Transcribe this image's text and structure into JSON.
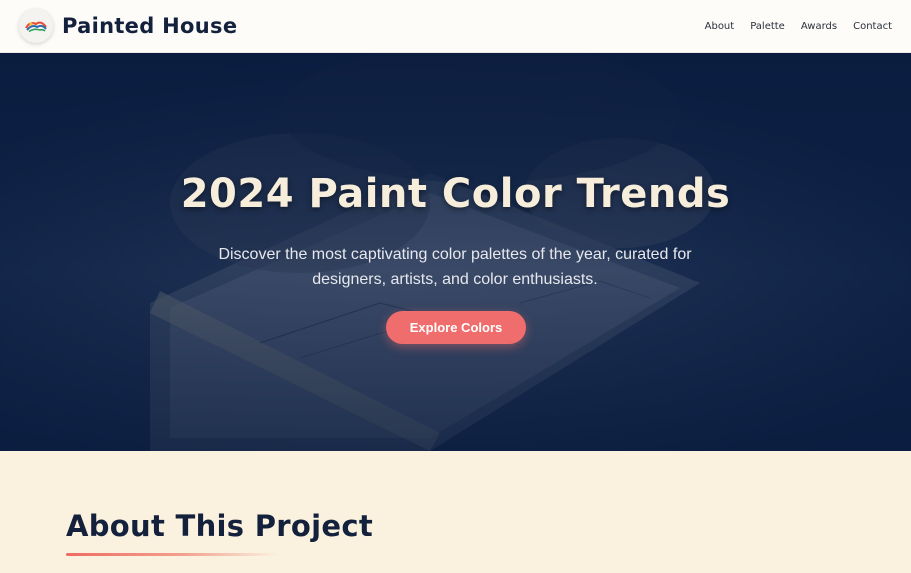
{
  "header": {
    "brand_name": "Painted House",
    "logo_icon": "paint-palette-logo-icon",
    "nav": [
      {
        "label": "About"
      },
      {
        "label": "Palette"
      },
      {
        "label": "Awards"
      },
      {
        "label": "Contact"
      }
    ]
  },
  "hero": {
    "title": "2024 Paint Color Trends",
    "subtitle": "Discover the most captivating color palettes of the year, curated for designers, artists, and color enthusiasts.",
    "cta_label": "Explore Colors"
  },
  "about": {
    "title": "About This Project"
  },
  "colors": {
    "navy": "#14213d",
    "hero_overlay": "#0e2246",
    "cream": "#faf2de",
    "coral": "#f06d6d",
    "title_cream": "#f7eddb"
  }
}
